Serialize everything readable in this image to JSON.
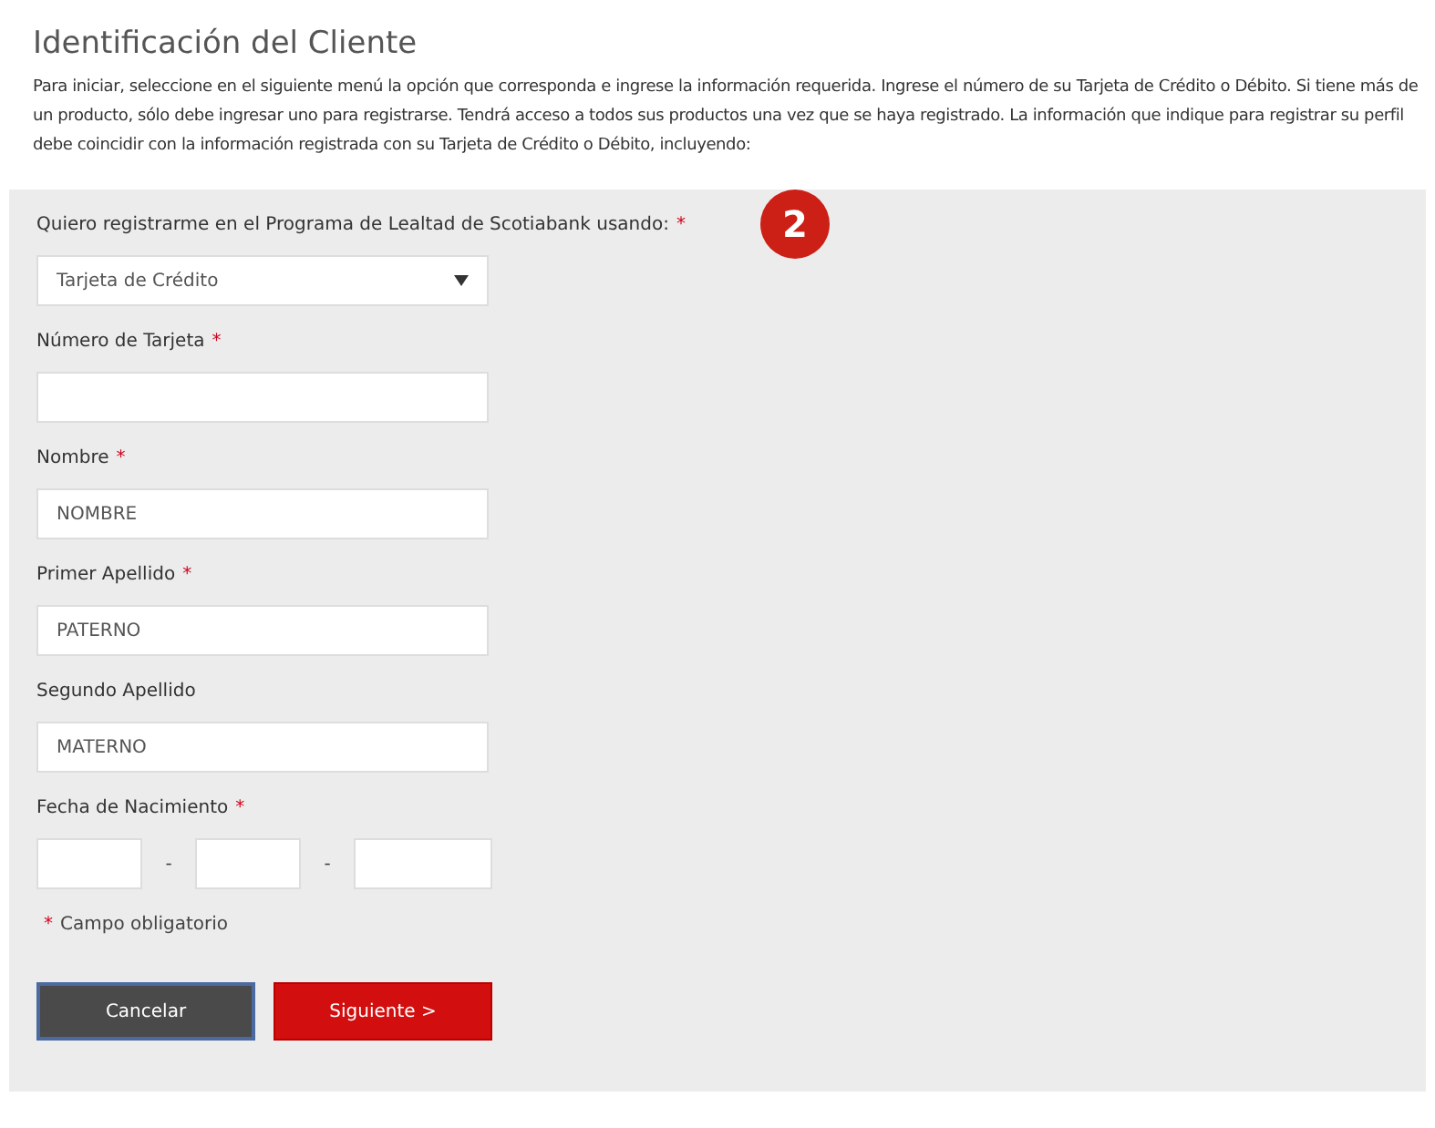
{
  "title": "Identificación del Cliente",
  "intro": "Para iniciar, seleccione en el siguiente menú la opción que corresponda e ingrese la información requerida. Ingrese el número de su Tarjeta de Crédito o Débito. Si tiene más de un producto, sólo debe ingresar uno para registrarse. Tendrá acceso a todos sus productos una vez que se haya registrado. La información que indique para registrar su perfil debe coincidir con la información registrada con su Tarjeta de Crédito o Débito, incluyendo:",
  "badge": "2",
  "fields": [
    {
      "kind": "select",
      "label": "Quiero registrarme en el Programa de Lealtad de Scotiabank usando:",
      "required_mark": "*",
      "value": "Tarjeta de Crédito"
    },
    {
      "kind": "text",
      "label": "Número de Tarjeta",
      "required_mark": "*"
    },
    {
      "kind": "text",
      "label": "Nombre",
      "required_mark": "*",
      "value": "NOMBRE"
    },
    {
      "kind": "text",
      "label": "Primer Apellido",
      "required_mark": "*",
      "value": "PATERNO"
    },
    {
      "kind": "text",
      "label": "Segundo Apellido",
      "value": "MATERNO"
    },
    {
      "kind": "date",
      "label": "Fecha de Nacimiento",
      "required_mark": "*",
      "separators": [
        "-",
        "-"
      ]
    }
  ],
  "required_note": {
    "mark": "*",
    "text": "Campo obligatorio"
  },
  "buttons": [
    {
      "kind": "secondary",
      "label": "Cancelar"
    },
    {
      "kind": "primary",
      "label": "Siguiente >"
    }
  ]
}
